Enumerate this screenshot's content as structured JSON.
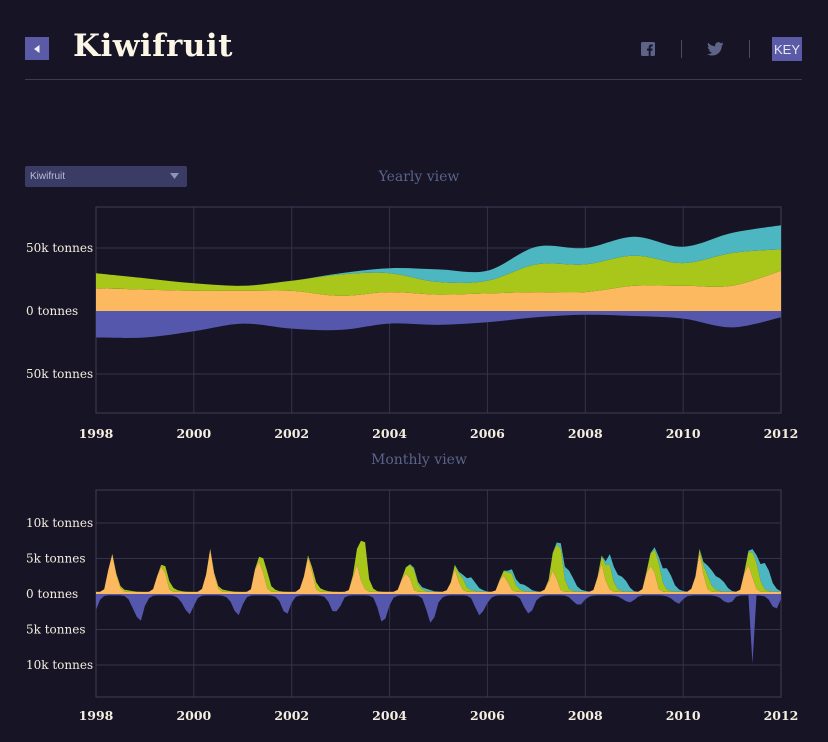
{
  "header": {
    "title": "Kiwifruit",
    "key_label": "KEY"
  },
  "icons": {
    "back": "back-arrow-icon",
    "facebook": "facebook-icon",
    "twitter": "twitter-icon",
    "dropdown": "chevron-down-icon"
  },
  "controls": {
    "product_select_value": "Kiwifruit"
  },
  "colors": {
    "background": "#161425",
    "accent": "#5b5aa6",
    "series_orange": "#fdb95f",
    "series_green": "#a8c71a",
    "series_teal": "#4cb6c1",
    "series_blue": "#5557ad"
  },
  "chart_data": [
    {
      "type": "area",
      "title": "Yearly view",
      "x": [
        1998,
        1999,
        2000,
        2001,
        2002,
        2003,
        2004,
        2005,
        2006,
        2007,
        2008,
        2009,
        2010,
        2011,
        2012
      ],
      "xticks": [
        "1998",
        "2000",
        "2002",
        "2004",
        "2006",
        "2008",
        "2010",
        "2012"
      ],
      "yticks": [
        {
          "value": 50000,
          "label": "50k tonnes"
        },
        {
          "value": 0,
          "label": "0 tonnes"
        },
        {
          "value": -50000,
          "label": "50k tonnes"
        }
      ],
      "ylim": [
        -82000,
        82000
      ],
      "grid": true,
      "series": [
        {
          "color": "#fdb95f",
          "values": [
            18000,
            17000,
            16000,
            16000,
            16000,
            12000,
            15000,
            13000,
            14000,
            15000,
            15000,
            20000,
            20000,
            20000,
            32000
          ]
        },
        {
          "color": "#a8c71a",
          "values": [
            12000,
            9000,
            6000,
            4000,
            8000,
            17000,
            15000,
            10000,
            10000,
            22000,
            22000,
            24000,
            18000,
            26000,
            17000
          ]
        },
        {
          "color": "#4cb6c1",
          "values": [
            0,
            0,
            0,
            0,
            0,
            1000,
            4000,
            10000,
            8000,
            14000,
            13000,
            15000,
            13000,
            16000,
            19000
          ]
        },
        {
          "color": "#5557ad",
          "values": [
            -21000,
            -21000,
            -16000,
            -10000,
            -14000,
            -15000,
            -10000,
            -11000,
            -9000,
            -5000,
            -3000,
            -4000,
            -6000,
            -13000,
            -5000
          ]
        }
      ]
    },
    {
      "type": "area",
      "title": "Monthly view",
      "x_start": "1998-01",
      "x_end": "2012-01",
      "xticks": [
        "1998",
        "2000",
        "2002",
        "2004",
        "2006",
        "2008",
        "2010",
        "2012"
      ],
      "yticks": [
        {
          "value": 10000,
          "label": "10k tonnes"
        },
        {
          "value": 5000,
          "label": "5k tonnes"
        },
        {
          "value": 0,
          "label": "0 tonnes"
        },
        {
          "value": -5000,
          "label": "5k tonnes"
        },
        {
          "value": -10000,
          "label": "10k tonnes"
        }
      ],
      "ylim": [
        -15000,
        15000
      ],
      "grid": true,
      "seasonal_peaks": {
        "orange": [
          6000,
          4800,
          6000,
          5800,
          5500,
          4200,
          3600,
          3200,
          3000,
          3500,
          4200,
          5200,
          5500,
          4800,
          5000
        ],
        "green": [
          200,
          1200,
          300,
          2600,
          1200,
          7800,
          3800,
          1800,
          2800,
          7600,
          4200,
          5200,
          2200,
          5800,
          3000
        ],
        "teal": [
          0,
          0,
          0,
          0,
          0,
          0,
          500,
          1800,
          1400,
          2600,
          3400,
          3000,
          3200,
          3800,
          2800
        ],
        "blue": [
          -5500,
          -3500,
          -3200,
          -2800,
          -2500,
          -4000,
          -4400,
          -3600,
          -3800,
          -2200,
          -1500,
          -1500,
          -1200,
          -2000,
          -1200
        ]
      },
      "annotations": [
        {
          "x": "2011-06",
          "value": -9800,
          "note": "single-month spike"
        }
      ]
    }
  ]
}
